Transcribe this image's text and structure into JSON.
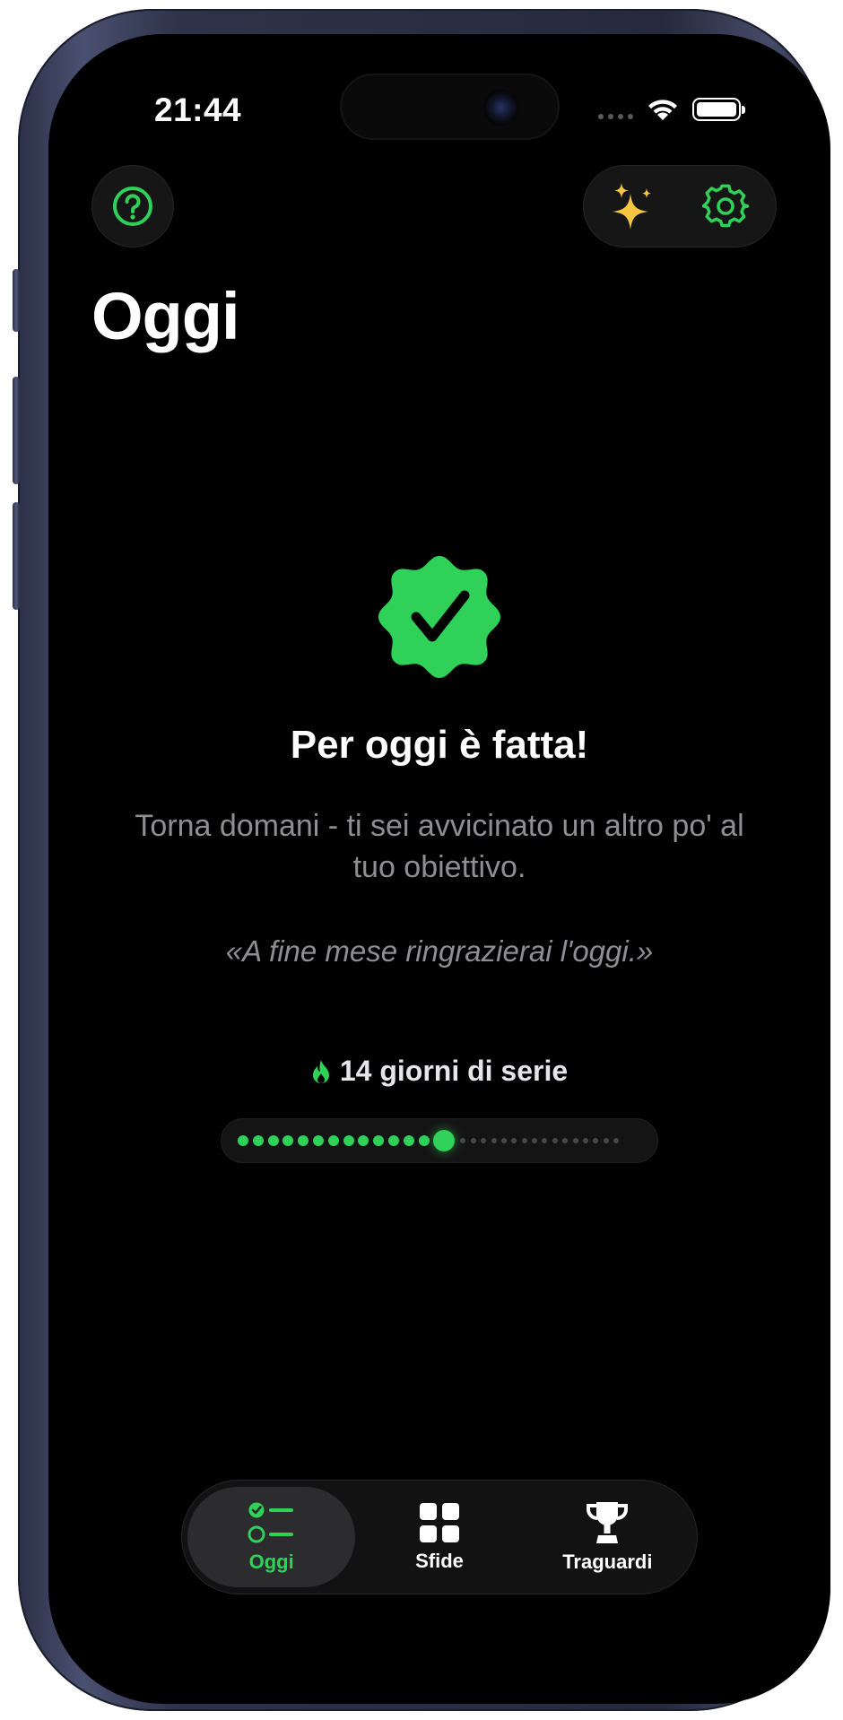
{
  "status_bar": {
    "time": "21:44",
    "icons": [
      "signal-icon",
      "wifi-icon",
      "battery-icon"
    ]
  },
  "header": {
    "help_icon": "question-circle-icon",
    "sparkles_icon": "sparkles-icon",
    "settings_icon": "gear-icon",
    "title": "Oggi"
  },
  "completion": {
    "badge_icon": "checkmark-seal-icon",
    "title": "Per oggi è fatta!",
    "subtitle": "Torna domani - ti sei avvicinato un altro po' al tuo obiettivo.",
    "quote": "«A fine mese ringrazierai l'oggi.»"
  },
  "streak": {
    "icon": "flame-icon",
    "label": "14 giorni di serie",
    "days_completed": 14,
    "total_days": 30
  },
  "tabbar": {
    "tabs": [
      {
        "label": "Oggi",
        "icon": "checklist-icon",
        "active": true
      },
      {
        "label": "Sfide",
        "icon": "grid-icon",
        "active": false
      },
      {
        "label": "Traguardi",
        "icon": "trophy-icon",
        "active": false
      }
    ]
  },
  "colors": {
    "accent": "#30d158",
    "background": "#000000",
    "secondary_text": "#8e8e93",
    "sparkles": "#f5c542"
  }
}
